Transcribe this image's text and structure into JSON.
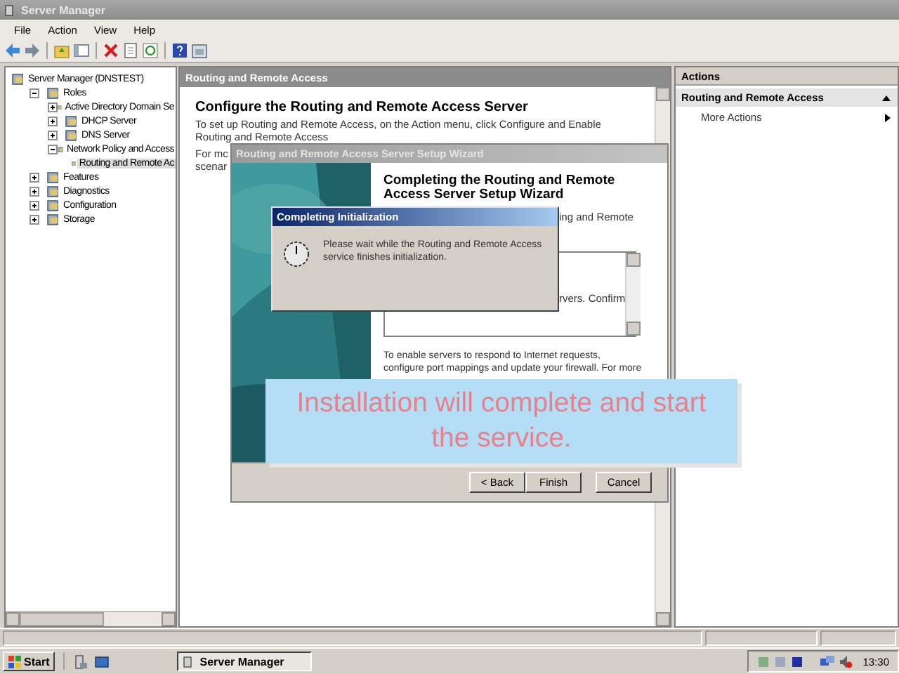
{
  "window": {
    "title": "Server Manager"
  },
  "menu": [
    "File",
    "Action",
    "View",
    "Help"
  ],
  "tree": [
    {
      "label": "Server Manager (DNSTEST)",
      "selected": false,
      "children": [
        {
          "label": "Roles",
          "expanded": true,
          "selected": false,
          "children": [
            {
              "label": "Active Directory Domain Se",
              "expanded": false,
              "selected": false
            },
            {
              "label": "DHCP Server",
              "expanded": false,
              "selected": false
            },
            {
              "label": "DNS Server",
              "expanded": false,
              "selected": false
            },
            {
              "label": "Network Policy and Access",
              "expanded": true,
              "selected": false,
              "children": [
                {
                  "label": "Routing and Remote Ac",
                  "selected": true
                }
              ]
            }
          ]
        },
        {
          "label": "Features",
          "expanded": false,
          "selected": false
        },
        {
          "label": "Diagnostics",
          "expanded": false,
          "selected": false
        },
        {
          "label": "Configuration",
          "expanded": false,
          "selected": false
        },
        {
          "label": "Storage",
          "expanded": false,
          "selected": false
        }
      ]
    }
  ],
  "center": {
    "header": "Routing and Remote Access",
    "heading": "Configure the Routing and Remote Access Server",
    "intro": [
      "To set up Routing and Remote Access, on the Action menu, click Configure and Enable",
      "Routing and Remote Access"
    ],
    "more": [
      "For mc",
      "scenar"
    ]
  },
  "actions": {
    "header": "Actions",
    "section": {
      "title": "Routing and Remote Access",
      "expanded": true
    },
    "items": [
      "More Actions"
    ]
  },
  "wizard": {
    "title": "Routing and Remote Access Server Setup Wizard",
    "heading": "Completing the Routing and Remote Access Server Setup Wizard",
    "fragment": "ing and Remote",
    "list_fragment": "rvers. Confirm",
    "note": [
      "To enable servers to respond to Internet requests,",
      "configure port mappings and update your firewall. For more"
    ],
    "buttons": [
      "< Back",
      "Finish",
      "Cancel"
    ]
  },
  "init_dialog": {
    "title": "Completing Initialization",
    "message": "Please wait while the Routing and Remote Access service finishes initialization."
  },
  "caption": {
    "lines": [
      "Installation will complete and start",
      "the service."
    ]
  },
  "taskbar": {
    "start": "Start",
    "tasks": [
      {
        "label": "Server Manager",
        "selected": true
      }
    ],
    "clock": "13:30"
  }
}
